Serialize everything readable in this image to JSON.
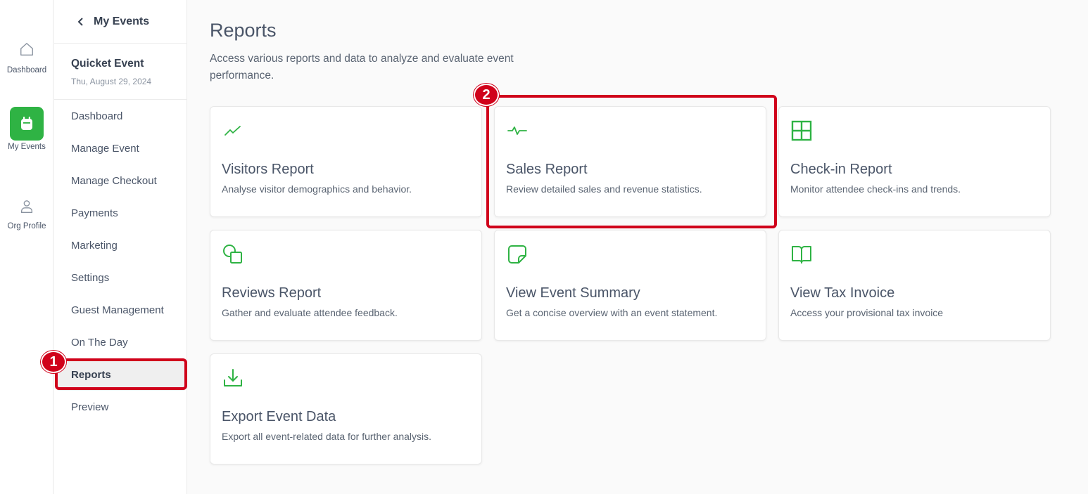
{
  "rail": {
    "items": [
      {
        "label": "Dashboard",
        "icon": "home-icon"
      },
      {
        "label": "My Events",
        "icon": "calendar-icon"
      },
      {
        "label": "Org Profile",
        "icon": "user-icon"
      }
    ]
  },
  "event_nav": {
    "back_label": "My Events",
    "event_name": "Quicket Event",
    "event_date": "Thu, August 29, 2024",
    "items": [
      {
        "label": "Dashboard"
      },
      {
        "label": "Manage Event"
      },
      {
        "label": "Manage Checkout"
      },
      {
        "label": "Payments"
      },
      {
        "label": "Marketing"
      },
      {
        "label": "Settings"
      },
      {
        "label": "Guest Management"
      },
      {
        "label": "On The Day"
      },
      {
        "label": "Reports"
      },
      {
        "label": "Preview"
      }
    ]
  },
  "main": {
    "title": "Reports",
    "description": "Access various reports and data to analyze and evaluate event performance.",
    "cards": [
      {
        "title": "Visitors Report",
        "description": "Analyse visitor demographics and behavior.",
        "icon": "trending-line-icon"
      },
      {
        "title": "Sales Report",
        "description": "Review detailed sales and revenue statistics.",
        "icon": "activity-pulse-icon"
      },
      {
        "title": "Check-in Report",
        "description": "Monitor attendee check-ins and trends.",
        "icon": "grid-icon"
      },
      {
        "title": "Reviews Report",
        "description": "Gather and evaluate attendee feedback.",
        "icon": "shapes-icon"
      },
      {
        "title": "View Event Summary",
        "description": "Get a concise overview with an event statement.",
        "icon": "sticky-note-icon"
      },
      {
        "title": "View Tax Invoice",
        "description": "Access your provisional tax invoice",
        "icon": "book-open-icon"
      },
      {
        "title": "Export Event Data",
        "description": "Export all event-related data for further analysis.",
        "icon": "download-icon"
      }
    ]
  },
  "annotations": {
    "badge_1": "1",
    "badge_2": "2"
  },
  "colors": {
    "accent_green": "#2fb344",
    "annotation_red": "#d0021b"
  }
}
